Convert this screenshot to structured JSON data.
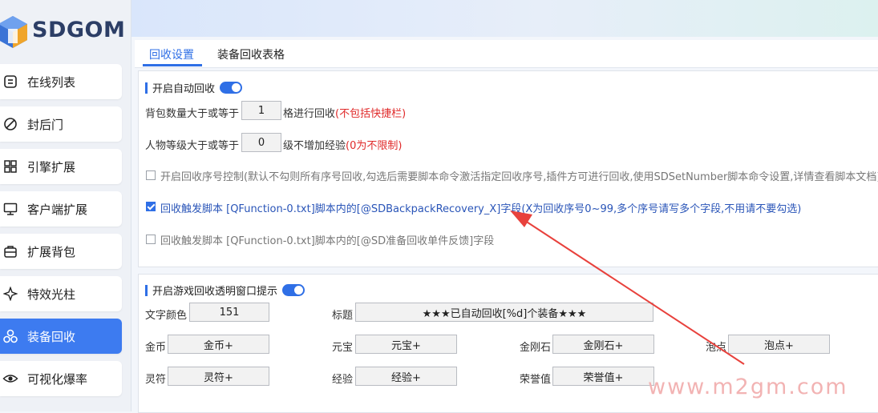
{
  "brand": {
    "name": "SDGOM"
  },
  "sidebar": {
    "items": [
      {
        "label": "在线列表",
        "icon": "list-icon"
      },
      {
        "label": "封后门",
        "icon": "ban-icon"
      },
      {
        "label": "引擎扩展",
        "icon": "grid-icon"
      },
      {
        "label": "客户端扩展",
        "icon": "monitor-icon"
      },
      {
        "label": "扩展背包",
        "icon": "bag-icon"
      },
      {
        "label": "特效光柱",
        "icon": "sparkle-icon"
      },
      {
        "label": "装备回收",
        "icon": "recycle-icon",
        "active": true
      },
      {
        "label": "可视化爆率",
        "icon": "eye-icon"
      }
    ]
  },
  "tabs": [
    {
      "label": "回收设置",
      "active": true
    },
    {
      "label": "装备回收表格",
      "active": false
    }
  ],
  "auto_recycle": {
    "title": "开启自动回收",
    "enabled": true,
    "bag_count": {
      "prefix": "背包数量大于或等于",
      "value": "1",
      "suffix": "格进行回收",
      "note": "(不包括快捷栏)"
    },
    "level": {
      "prefix": "人物等级大于或等于",
      "value": "0",
      "suffix": "级不增加经验",
      "note": "(0为不限制)"
    },
    "options": [
      {
        "checked": false,
        "text": "开启回收序号控制(默认不勾则所有序号回收,勾选后需要脚本命令激活指定回收序号,插件方可进行回收,使用SDSetNumber脚本命令设置,详情查看脚本文档)"
      },
      {
        "checked": true,
        "text": "回收触发脚本 [QFunction-0.txt]脚本内的[@SDBackpackRecovery_X]字段(X为回收序号0~99,多个序号请写多个字段,不用请不要勾选)"
      },
      {
        "checked": false,
        "text": "回收触发脚本 [QFunction-0.txt]脚本内的[@SD准备回收单件反馈]字段"
      }
    ]
  },
  "popup": {
    "title": "开启游戏回收透明窗口提示",
    "enabled": true,
    "text_color": {
      "label": "文字颜色",
      "value": "151"
    },
    "caption": {
      "label": "标题",
      "value": "★★★已自动回收[%d]个装备★★★"
    },
    "fields": [
      {
        "label": "金币",
        "value": "金币+"
      },
      {
        "label": "元宝",
        "value": "元宝+"
      },
      {
        "label": "金刚石",
        "value": "金刚石+"
      },
      {
        "label": "泡点",
        "value": "泡点+"
      },
      {
        "label": "灵符",
        "value": "灵符+"
      },
      {
        "label": "经验",
        "value": "经验+"
      },
      {
        "label": "荣誉值",
        "value": "荣誉值+"
      }
    ]
  },
  "watermark": "www.m2gm.com",
  "colors": {
    "accent": "#2f6fe6",
    "warning": "#e02a2a",
    "arrow": "#e8413c"
  }
}
